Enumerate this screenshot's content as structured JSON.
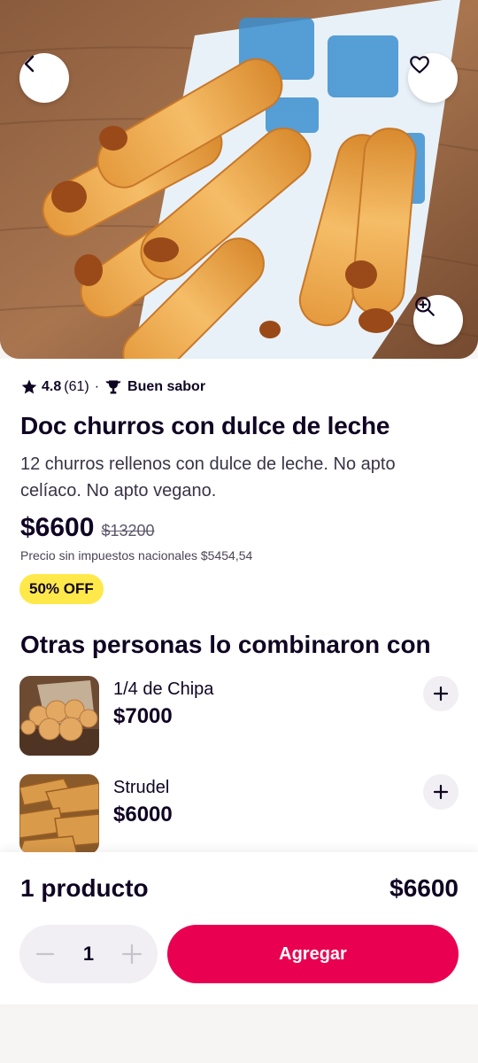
{
  "product": {
    "rating": "4.8",
    "rating_count": "(61)",
    "separator": "·",
    "tag": "Buen sabor",
    "title": "Doc churros con dulce de leche",
    "description": "12 churros rellenos con dulce de leche. No apto celíaco. No apto vegano.",
    "price": "$6600",
    "old_price": "$13200",
    "tax_note": "Precio sin impuestos nacionales $5454,54",
    "discount_badge": "50% OFF"
  },
  "combos": {
    "title": "Otras personas lo combinaron con",
    "items": [
      {
        "name": "1/4 de Chipa",
        "price": "$7000"
      },
      {
        "name": "Strudel",
        "price": "$6000"
      }
    ]
  },
  "footer": {
    "summary_label": "1 producto",
    "summary_total": "$6600",
    "quantity": "1",
    "add_label": "Agregar"
  },
  "colors": {
    "primary": "#ea0050",
    "badge": "#ffe94a",
    "text": "#100423"
  },
  "icons": [
    "back-arrow-icon",
    "heart-icon",
    "zoom-in-icon",
    "star-icon",
    "trophy-icon",
    "plus-icon",
    "minus-icon"
  ]
}
